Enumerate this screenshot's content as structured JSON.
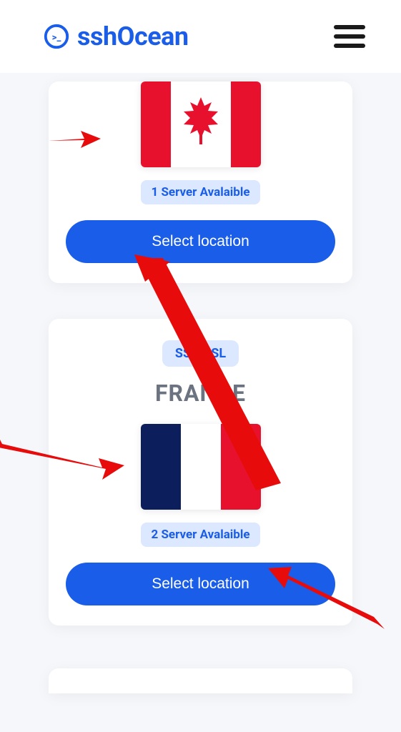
{
  "header": {
    "brand": "sshOcean"
  },
  "cards": {
    "canada": {
      "availability": "1 Server Avalaible",
      "button_label": "Select location"
    },
    "france": {
      "protocol_badge": "SSH SSL",
      "country": "FRANCE",
      "availability": "2 Server Avalaible",
      "button_label": "Select location"
    }
  }
}
